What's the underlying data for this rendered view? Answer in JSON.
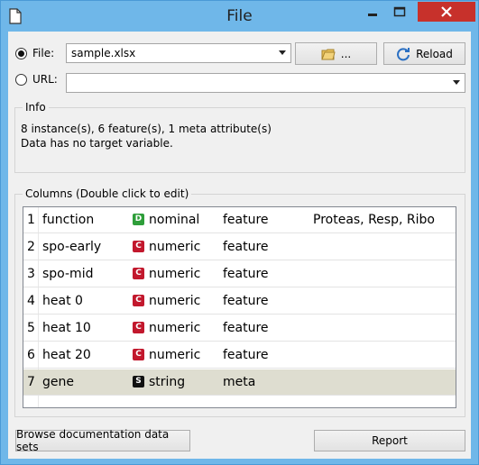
{
  "window": {
    "title": "File"
  },
  "source": {
    "file_label": "File:",
    "file_value": "sample.xlsx",
    "browse_label": "...",
    "reload_label": "Reload",
    "url_label": "URL:",
    "url_value": ""
  },
  "info": {
    "label": "Info",
    "line1": "8 instance(s), 6 feature(s), 1 meta attribute(s)",
    "line2": "Data has no target variable."
  },
  "columns": {
    "label": "Columns (Double click to edit)",
    "rows": [
      {
        "num": "1",
        "name": "function",
        "badge": "D",
        "type": "nominal",
        "role": "feature",
        "values": "Proteas, Resp, Ribo",
        "badge_color": "#2e9e3a"
      },
      {
        "num": "2",
        "name": "spo-early",
        "badge": "C",
        "type": "numeric",
        "role": "feature",
        "values": "",
        "badge_color": "#c2182d"
      },
      {
        "num": "3",
        "name": "spo-mid",
        "badge": "C",
        "type": "numeric",
        "role": "feature",
        "values": "",
        "badge_color": "#c2182d"
      },
      {
        "num": "4",
        "name": "heat 0",
        "badge": "C",
        "type": "numeric",
        "role": "feature",
        "values": "",
        "badge_color": "#c2182d"
      },
      {
        "num": "5",
        "name": "heat 10",
        "badge": "C",
        "type": "numeric",
        "role": "feature",
        "values": "",
        "badge_color": "#c2182d"
      },
      {
        "num": "6",
        "name": "heat 20",
        "badge": "C",
        "type": "numeric",
        "role": "feature",
        "values": "",
        "badge_color": "#c2182d"
      },
      {
        "num": "7",
        "name": "gene",
        "badge": "S",
        "type": "string",
        "role": "meta",
        "values": "",
        "badge_color": "#111111"
      }
    ]
  },
  "footer": {
    "browse_docs_label": "Browse documentation data sets",
    "report_label": "Report"
  }
}
